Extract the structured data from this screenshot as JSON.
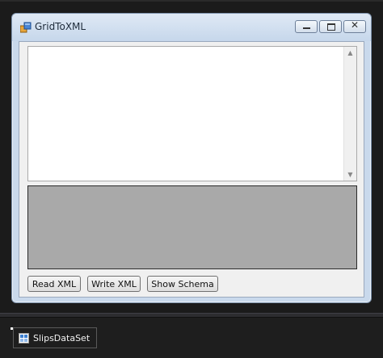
{
  "window": {
    "title": "GridToXML",
    "close_glyph": "✕"
  },
  "textbox": {
    "value": "",
    "scroll_up_glyph": "▲",
    "scroll_down_glyph": "▼"
  },
  "buttons": {
    "read_xml": "Read XML",
    "write_xml": "Write XML",
    "show_schema": "Show Schema"
  },
  "tray": {
    "component_label": "SlipsDataSet",
    "icon": "dataset-icon"
  },
  "colors": {
    "designer_background": "#1b1b1b",
    "window_titlebar": "#c6d7eb",
    "client_background": "#f0f0f0",
    "grid_background": "#a9a9a9"
  }
}
